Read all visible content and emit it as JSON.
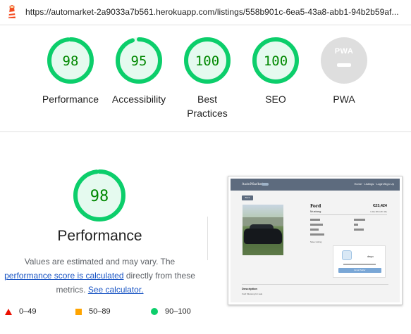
{
  "url_bar": {
    "url": "https://automarket-2a9033a7b561.herokuapp.com/listings/558b901c-6ea5-43a8-abb1-94b2b59af..."
  },
  "gauges": [
    {
      "label": "Performance",
      "score": 98
    },
    {
      "label": "Accessibility",
      "score": 95
    },
    {
      "label": "Best Practices",
      "score": 100
    },
    {
      "label": "SEO",
      "score": 100
    }
  ],
  "pwa": {
    "badge_text": "PWA",
    "label": "PWA"
  },
  "performance_detail": {
    "score": 98,
    "title": "Performance",
    "desc_prefix": "Values are estimated and may vary. The ",
    "desc_link1": "performance score is calculated",
    "desc_middle": " directly from these metrics. ",
    "desc_link2": "See calculator."
  },
  "legend": [
    {
      "shape": "triangle",
      "color": "#eb0f00",
      "range": "0–49"
    },
    {
      "shape": "square",
      "color": "#ffa400",
      "range": "50–89"
    },
    {
      "shape": "circle",
      "color": "#0cce6b",
      "range": "90–100"
    }
  ],
  "colors": {
    "pass_green": "#0cce6b",
    "pass_fill": "#e5faef",
    "pass_text": "#008800",
    "link": "#1a55c4"
  },
  "page_screenshot": {
    "logo": "AutoMarket",
    "nav_links": "Home · Listings · Login/Sign Up",
    "back": "Back",
    "make": "Ford",
    "model": "Mustang",
    "price": "€23,424",
    "price_sub": "1 dia 18 km/h 44e",
    "save_listing": "Save Listing",
    "seller_name": "dayo",
    "contact_button": "Email Seller",
    "description_title": "Description",
    "description_text": "Ford Mustang for sale"
  }
}
